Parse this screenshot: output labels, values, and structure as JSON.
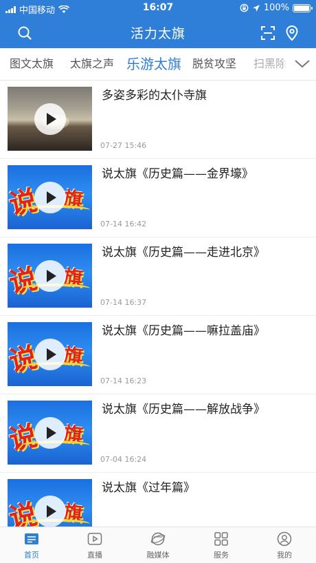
{
  "status_bar": {
    "carrier": "中国移动",
    "time": "16:07",
    "battery": "100%",
    "battery_level": 1.0
  },
  "header": {
    "title": "活力太旗",
    "icons": [
      "search-icon",
      "scan-icon",
      "location-icon"
    ]
  },
  "tabs": [
    {
      "label": "图文太旗"
    },
    {
      "label": "太旗之声"
    },
    {
      "label": "乐游太旗",
      "active": true
    },
    {
      "label": "脱贫攻坚"
    },
    {
      "label": "扫黑除"
    }
  ],
  "feed": [
    {
      "title": "多姿多彩的太仆寺旗",
      "time": "07-27 15:46",
      "thumb": "sunset-landscape"
    },
    {
      "title": "说太旗《历史篇——金界壕》",
      "time": "07-14 16:42",
      "thumb": "shuo-taiqi-logo"
    },
    {
      "title": "说太旗《历史篇——走进北京》",
      "time": "07-14 16:37",
      "thumb": "shuo-taiqi-logo"
    },
    {
      "title": "说太旗《历史篇——嘛拉盖庙》",
      "time": "07-14 16:23",
      "thumb": "shuo-taiqi-logo"
    },
    {
      "title": "说太旗《历史篇——解放战争》",
      "time": "07-04 16:24",
      "thumb": "shuo-taiqi-logo"
    },
    {
      "title": "说太旗《过年篇》",
      "time": "",
      "thumb": "shuo-taiqi-logo"
    }
  ],
  "thumb_text": {
    "c1": "说",
    "c2": "旗"
  },
  "bottom_nav": [
    {
      "label": "首页",
      "icon": "home-news-icon",
      "active": true
    },
    {
      "label": "直播",
      "icon": "live-play-icon"
    },
    {
      "label": "融媒体",
      "icon": "media-globe-icon"
    },
    {
      "label": "服务",
      "icon": "grid-service-icon"
    },
    {
      "label": "我的",
      "icon": "profile-icon"
    }
  ],
  "colors": {
    "accent": "#2f7fd8",
    "text": "#222222",
    "muted": "#999999"
  }
}
